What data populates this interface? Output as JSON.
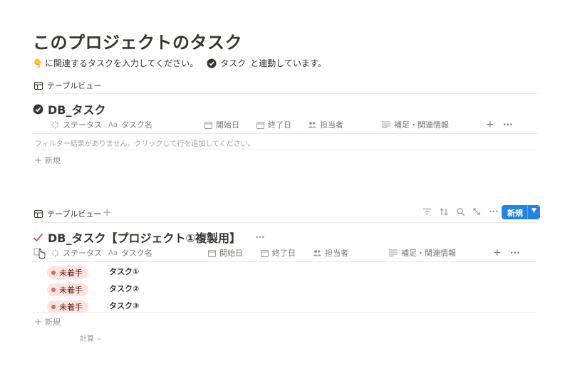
{
  "page": {
    "title": "このプロジェクトのタスク",
    "description": {
      "emoji": "👇",
      "text_before": "に関連するタスクを入力してください。",
      "linked_db": "タスク",
      "text_after": "と連動しています。"
    }
  },
  "block1": {
    "view_tab": "テーブルビュー",
    "db_title": "DB_タスク",
    "columns": {
      "status": "ステータス",
      "task_name": "タスク名",
      "start": "開始日",
      "end": "終了日",
      "assignee": "担当者",
      "notes": "補足・関連情報"
    },
    "column_type_text": "Aa",
    "empty_message": "フィルター結果がありません。クリックして行を追加してください。",
    "new_label": "新規"
  },
  "block2": {
    "view_tab": "テーブルビュー",
    "db_title": "DB_タスク【プロジェクト①複製用】",
    "more": "···",
    "new_button": "新規",
    "columns": {
      "status": "ステータス",
      "task_name": "タスク名",
      "start": "開始日",
      "end": "終了日",
      "assignee": "担当者",
      "notes": "補足・関連情報"
    },
    "column_type_text": "Aa",
    "rows": [
      {
        "status": "未着手",
        "name": "タスク①"
      },
      {
        "status": "未着手",
        "name": "タスク②"
      },
      {
        "status": "未着手",
        "name": "タスク③"
      }
    ],
    "new_label": "新規",
    "calc_label": "計算"
  },
  "colors": {
    "accent": "#2383e2",
    "badge_bg": "#fde4df",
    "badge_dot": "#e16259",
    "check_red": "#d44c47"
  }
}
